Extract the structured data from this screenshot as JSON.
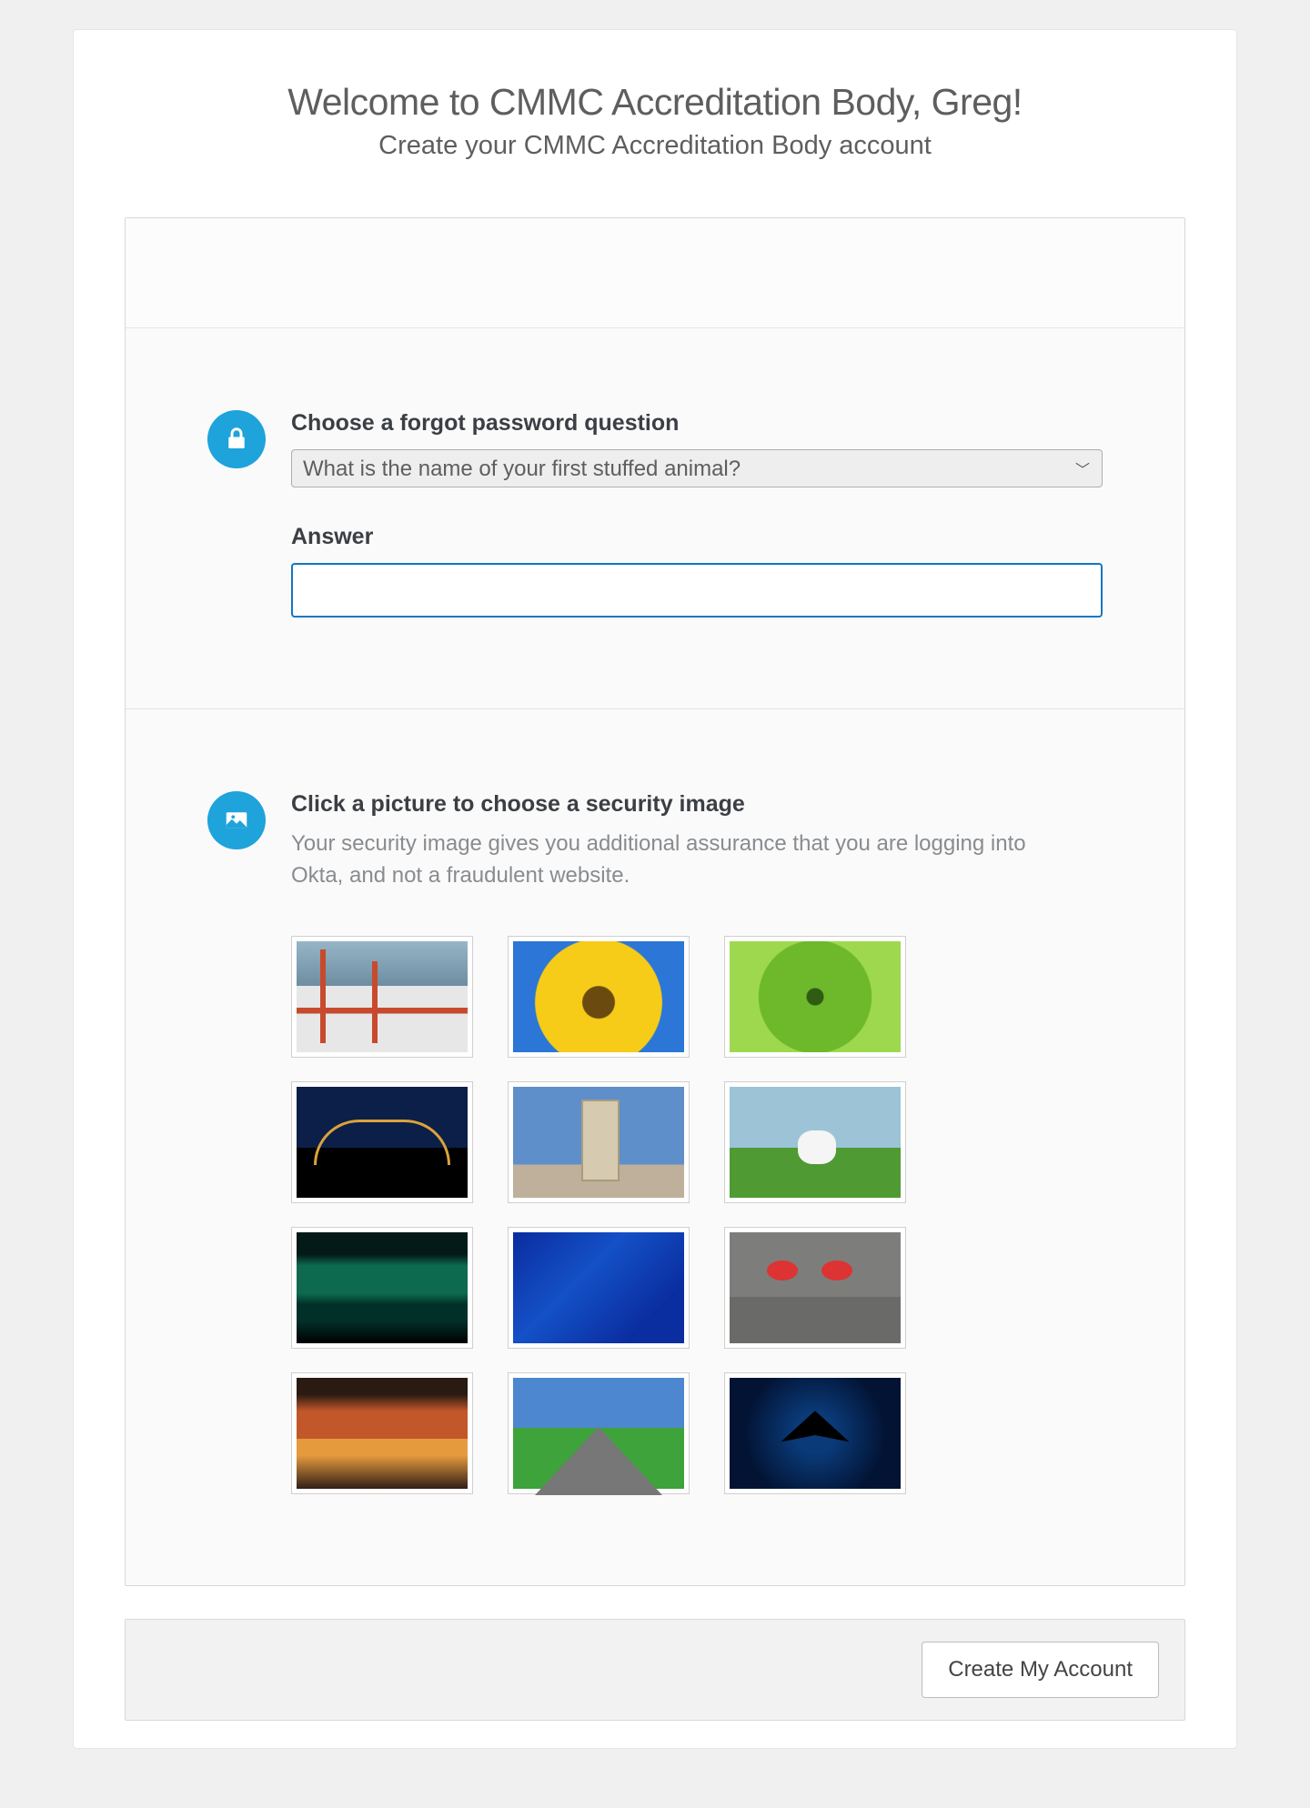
{
  "header": {
    "title": "Welcome to CMMC Accreditation Body, Greg!",
    "subtitle": "Create your CMMC Accreditation Body account"
  },
  "colors": {
    "accent": "#1ea3db",
    "input_focus_border": "#1477c0"
  },
  "security_question": {
    "label": "Choose a forgot password question",
    "selected": "What is the name of your first stuffed animal?",
    "answer_label": "Answer",
    "answer_value": ""
  },
  "security_image": {
    "title": "Click a picture to choose a security image",
    "description": "Your security image gives you additional assurance that you are logging into Okta, and not a fraudulent website.",
    "images": [
      {
        "name": "golden-gate-bridge"
      },
      {
        "name": "sunflower"
      },
      {
        "name": "green-succulent"
      },
      {
        "name": "harbour-bridge-night"
      },
      {
        "name": "brooklyn-bridge"
      },
      {
        "name": "sheep-field"
      },
      {
        "name": "aurora-borealis"
      },
      {
        "name": "blue-circuit"
      },
      {
        "name": "toy-robot"
      },
      {
        "name": "sunset-clouds"
      },
      {
        "name": "open-road"
      },
      {
        "name": "manta-ray"
      }
    ]
  },
  "footer": {
    "create_button": "Create My Account"
  }
}
